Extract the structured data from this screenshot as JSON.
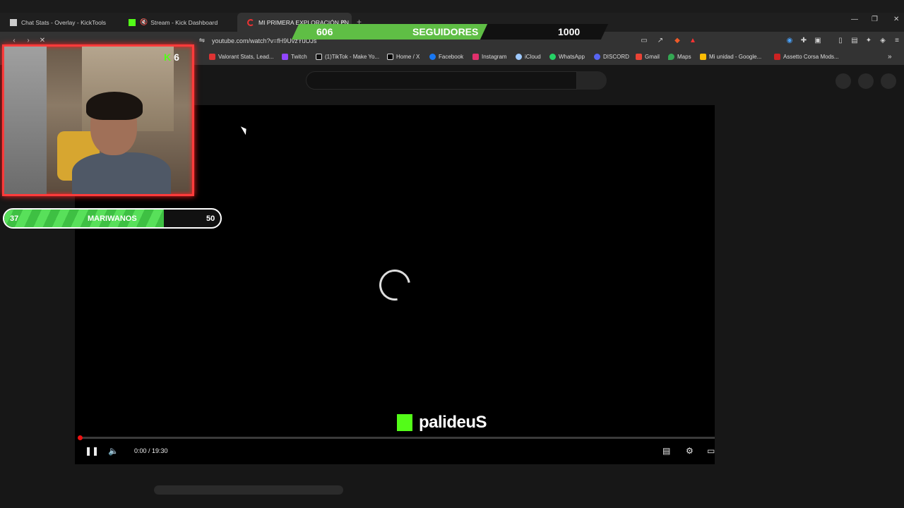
{
  "tabs": [
    {
      "label": "Chat Stats - Overlay - KickTools",
      "active": false
    },
    {
      "label": "Stream - Kick Dashboard",
      "active": false
    },
    {
      "label": "MI PRIMERA EXPLORACIÓN EN",
      "active": true
    }
  ],
  "address": {
    "url": "youtube.com/watch?v=fH9UvzYuOJs"
  },
  "bookmarks": [
    "Valorant Stats, Lead...",
    "Twitch",
    "(1)TikTok - Make Yo...",
    "Home / X",
    "Facebook",
    "Instagram",
    "iCloud",
    "WhatsApp",
    "DISCORD",
    "Gmail",
    "Maps",
    "Mi unidad - Google...",
    "Assetto Corsa Mods..."
  ],
  "followers_overlay": {
    "current": "606",
    "label": "SEGUIDORES",
    "goal": "1000",
    "progress": 0.606
  },
  "webcam_badge": {
    "letter": "K",
    "count": "6"
  },
  "goal_overlay": {
    "current": "37",
    "label": "MARIWANOS",
    "goal": "50",
    "progress": 0.74
  },
  "player": {
    "time": "0:00 / 19:30",
    "loading": true,
    "progress": 0.0
  },
  "channel": {
    "name": "palideuS"
  },
  "colors": {
    "kick_green": "#53fc18",
    "overlay_red": "#ff3b3b",
    "progress_red": "#e11111"
  }
}
